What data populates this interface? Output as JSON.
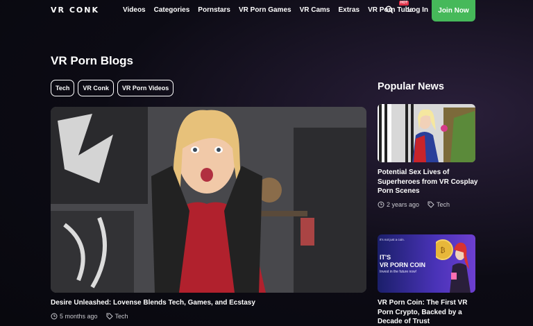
{
  "header": {
    "logo": "VR CONK",
    "nav": [
      "Videos",
      "Categories",
      "Pornstars",
      "VR Porn Games",
      "VR Cams",
      "Extras",
      "VR Porn Tube"
    ],
    "hot_badge": "HOT",
    "login": "Log In",
    "join": "Join Now"
  },
  "main": {
    "title": "VR Porn Blogs",
    "tags": [
      "Tech",
      "VR Conk",
      "VR Porn Videos"
    ],
    "featured": {
      "title": "Desire Unleashed: Lovense Blends Tech, Games, and Ecstasy",
      "time": "5 months ago",
      "tag": "Tech"
    }
  },
  "sidebar": {
    "title": "Popular News",
    "items": [
      {
        "title": "Potential Sex Lives of Superheroes from VR Cosplay Porn Scenes",
        "time": "2 years ago",
        "tag": "Tech"
      },
      {
        "title": "VR Porn Coin: The First VR Porn Crypto, Backed by a Decade of Trust",
        "banner_small": "It's not just a coin.",
        "banner_big1": "IT'S",
        "banner_big2": "VR PORN COIN",
        "banner_sub": "Invest in the future now!"
      }
    ]
  },
  "colors": {
    "accent": "#46b95a",
    "hot": "#e0344b",
    "background": "#0c0b14"
  },
  "icons": [
    "search-icon",
    "clock-icon",
    "tag-icon"
  ]
}
